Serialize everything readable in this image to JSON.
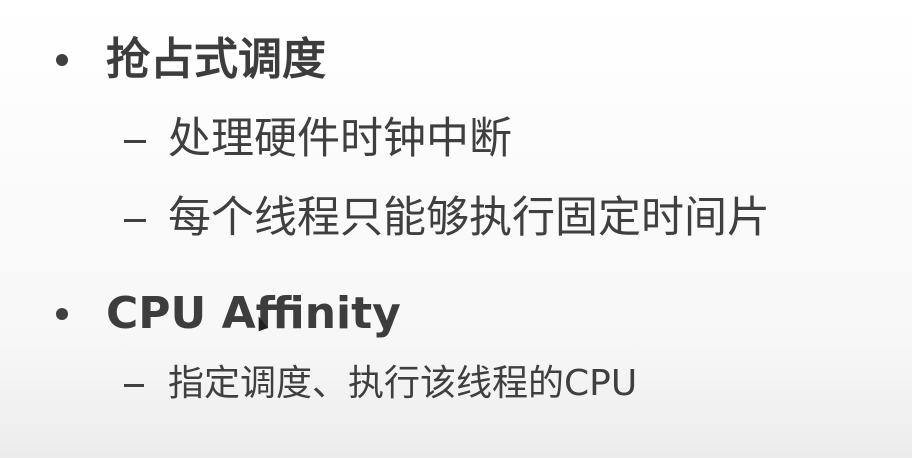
{
  "items": [
    {
      "label": "抢占式调度",
      "subitems": [
        "处理硬件时钟中断",
        "每个线程只能够执行固定时间片"
      ]
    },
    {
      "label": "CPU Affinity",
      "subitems": [
        "指定调度、执行该线程的CPU"
      ]
    }
  ]
}
